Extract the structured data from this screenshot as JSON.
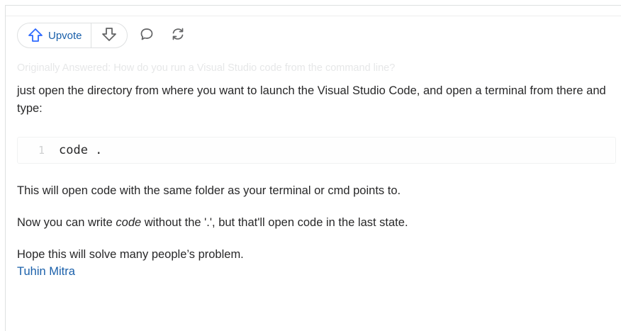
{
  "actions": {
    "upvote_label": "Upvote",
    "icons": {
      "upvote": "arrow-up-icon",
      "downvote": "arrow-down-icon",
      "comment": "comment-bubble-icon",
      "share": "share-cycle-icon"
    },
    "accent_color": "#195faa"
  },
  "answer": {
    "originally_answered": "Originally Answered: How do you run a Visual Studio code from the command line?",
    "intro": "just open the directory from where you want to launch the Visual Studio Code, and open a terminal from there and type:",
    "code": {
      "line_number": "1",
      "text": "code ."
    },
    "para2": "This will open code with the same folder as your terminal or cmd points to.",
    "para3": {
      "before": "Now you can write ",
      "emphasis": "code",
      "after": " without the '.', but that'll open code in the last state."
    },
    "para4": "Hope this will solve many people’s problem.",
    "author": "Tuhin Mitra"
  }
}
